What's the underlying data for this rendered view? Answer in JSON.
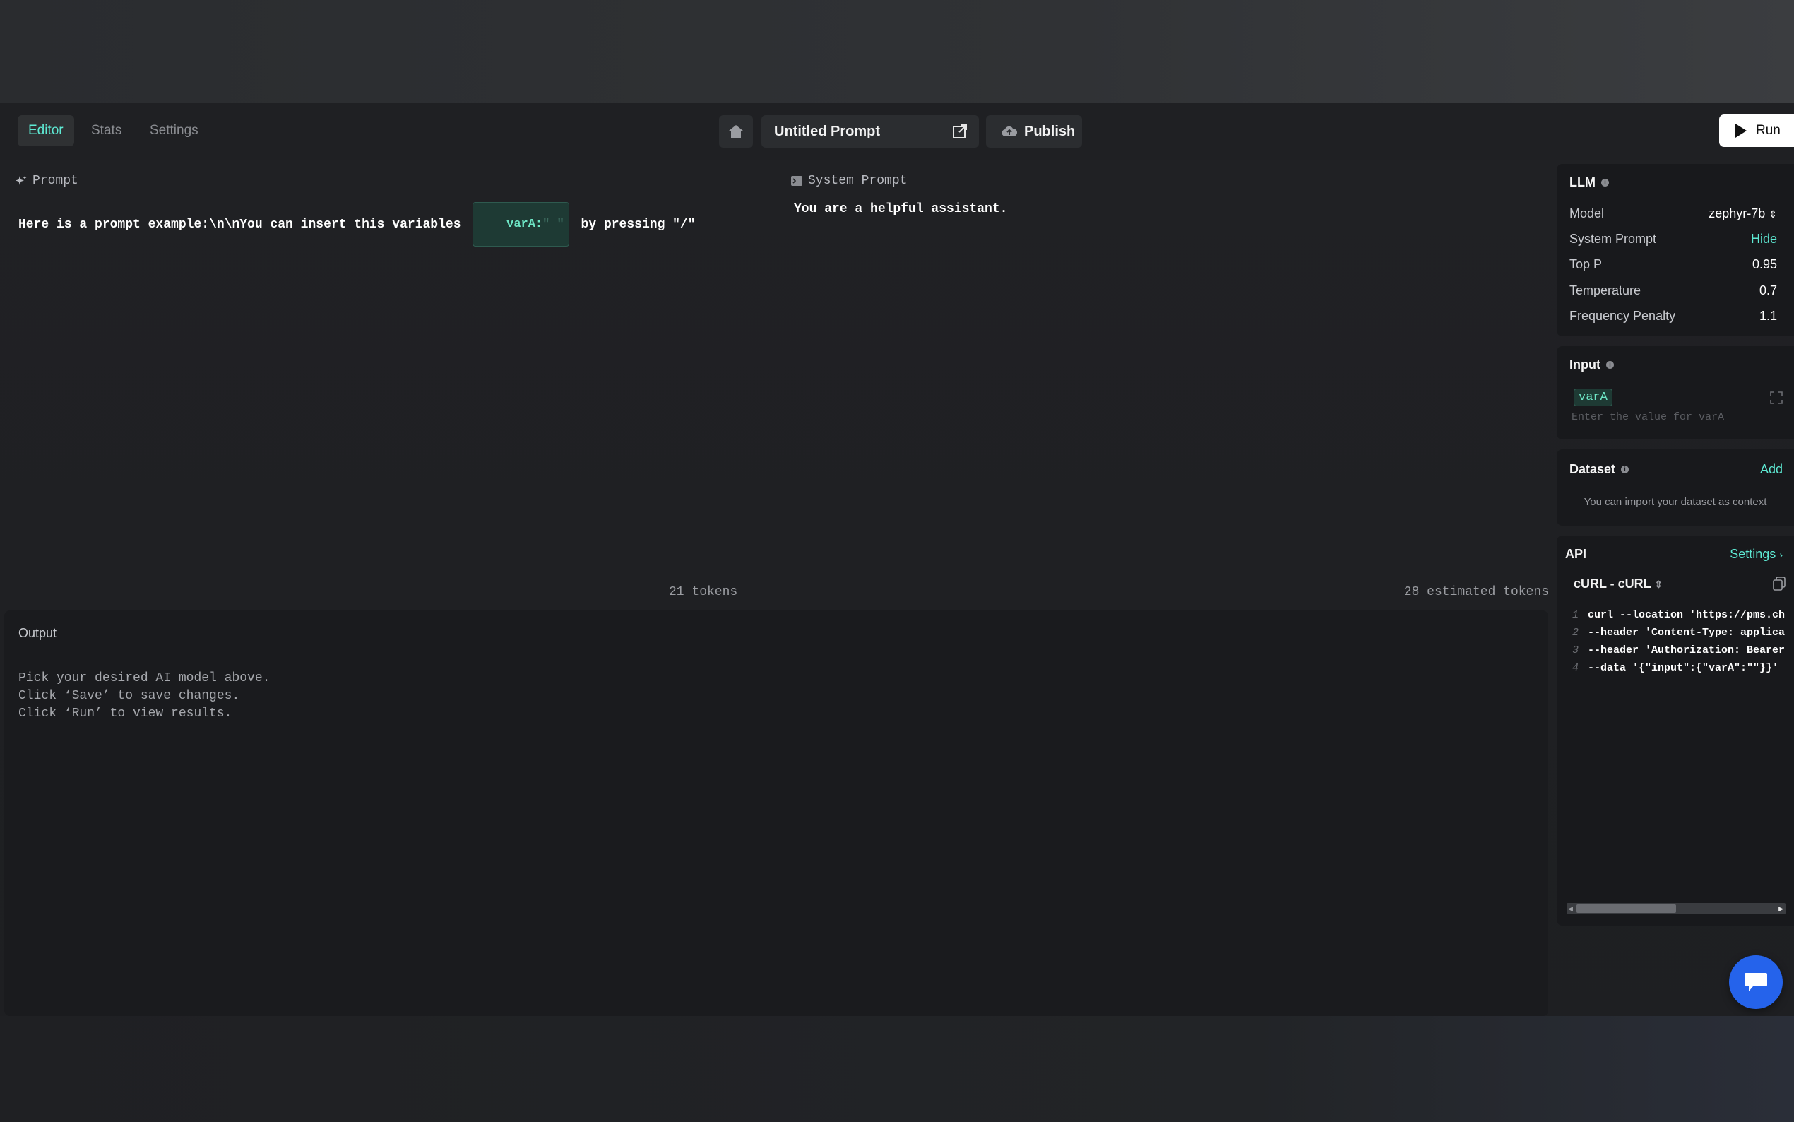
{
  "tabs": [
    {
      "label": "Editor",
      "active": true
    },
    {
      "label": "Stats",
      "active": false
    },
    {
      "label": "Settings",
      "active": false
    }
  ],
  "header": {
    "title": "Untitled Prompt",
    "publish_label": "Publish",
    "run_label": "Run"
  },
  "prompt": {
    "label": "Prompt",
    "text_before": "Here is a prompt example:\\n\\nYou can insert this variables ",
    "variable": "varA:",
    "variable_value": "\" \"",
    "text_after": " by pressing \"/\"",
    "tokens": "21 tokens"
  },
  "system_prompt": {
    "label": "System Prompt",
    "text": "You are a helpful assistant.",
    "tokens": "28 estimated tokens"
  },
  "output": {
    "label": "Output",
    "hint_lines": [
      "Pick your desired AI model above.",
      "Click ‘Save’ to save changes.",
      "Click ‘Run’ to view results."
    ]
  },
  "llm": {
    "title": "LLM",
    "rows": [
      {
        "label": "Model",
        "value": "zephyr-7b"
      },
      {
        "label": "System Prompt",
        "value": "Hide"
      },
      {
        "label": "Top P",
        "value": "0.95"
      },
      {
        "label": "Temperature",
        "value": "0.7"
      },
      {
        "label": "Frequency Penalty",
        "value": "1.1"
      }
    ]
  },
  "input": {
    "title": "Input",
    "variable": "varA",
    "placeholder": "Enter the value for varA"
  },
  "dataset": {
    "title": "Dataset",
    "add_label": "Add",
    "hint": "You can import your dataset as context"
  },
  "api": {
    "title": "API",
    "settings_label": "Settings",
    "language": "cURL - cURL",
    "lines": [
      {
        "n": "1",
        "code": "curl --location 'https://pms.ch"
      },
      {
        "n": "2",
        "code": "--header 'Content-Type: applica"
      },
      {
        "n": "3",
        "code": "--header 'Authorization: Bearer"
      },
      {
        "n": "4",
        "code": "--data '{\"input\":{\"varA\":\"\"}}'"
      }
    ],
    "scroll_fraction": 0.25
  },
  "colors": {
    "accent": "#5eead4",
    "fab": "#2563eb"
  }
}
